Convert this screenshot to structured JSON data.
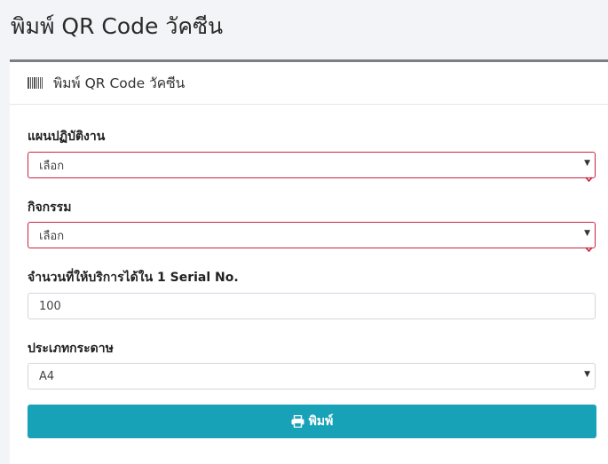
{
  "page": {
    "title": "พิมพ์ QR Code วัคซีน"
  },
  "card": {
    "title": "พิมพ์ QR Code วัคซีน",
    "icon": "barcode-icon"
  },
  "form": {
    "department": {
      "label": "แผนปฏิบัติงาน",
      "value": "เลือก",
      "invalid": true
    },
    "activity": {
      "label": "กิจกรรม",
      "value": "เลือก",
      "invalid": true
    },
    "quantity": {
      "label": "จำนวนที่ให้บริการได้ใน 1 Serial No.",
      "value": "100"
    },
    "paper": {
      "label": "ประเภทกระดาษ",
      "value": "A4"
    }
  },
  "actions": {
    "print_label": "พิมพ์",
    "print_icon": "print-icon"
  },
  "colors": {
    "primary": "#17a2b8",
    "invalid": "#c8233f",
    "card_top_border": "#7a7f86"
  }
}
